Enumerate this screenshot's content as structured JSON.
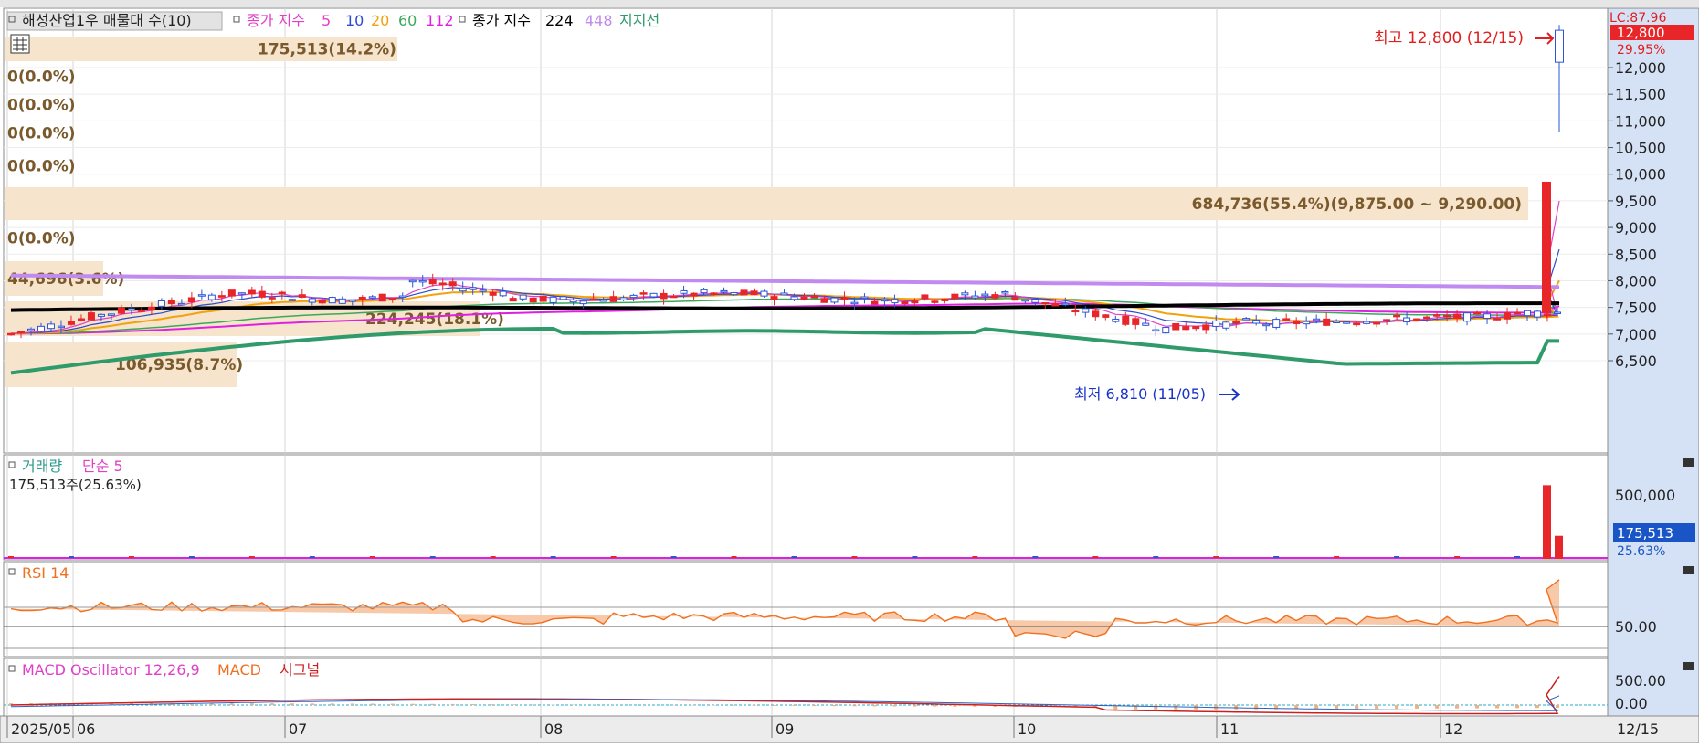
{
  "legends": {
    "price": {
      "title": "해성산업1우 매물대 수(10)",
      "ma_prefix": "종가 지수",
      "ma_periods": [
        "5",
        "10",
        "20",
        "60",
        "112"
      ],
      "long_prefix": "종가 지수",
      "long_periods": [
        "224",
        "448"
      ],
      "support": "지지선"
    },
    "volume": {
      "title": "거래량",
      "ma": "단순 5",
      "current": "175,513주(25.63%)"
    },
    "rsi": {
      "title": "RSI 14"
    },
    "macd": {
      "title": "MACD Oscillator 12,26,9",
      "macd": "MACD",
      "signal": "시그널"
    }
  },
  "colors": {
    "up": "#e8262a",
    "down": "#2b54d6",
    "ma5": "#e040c8",
    "ma10": "#2a4cd0",
    "ma20": "#f2a20c",
    "ma60": "#3aa95a",
    "ma112": "#e020e0",
    "ma224": "#000000",
    "ma448": "#c08af0",
    "support": "#2f9a6a",
    "rsi": "#f07020",
    "volume_profile": "#f6e4cc",
    "axis_bg": "#d5e2f5"
  },
  "annotations": {
    "high": "최고 12,800 (12/15)",
    "low": "최저 6,810 (11/05)",
    "lc": "LC:87.96",
    "price_tag": "12,800",
    "pct_tag": "29.95%",
    "vol_tag": "175,513",
    "vol_pct_tag": "25.63%",
    "end_date": "12/15"
  },
  "chart_data": [
    {
      "type": "candlestick",
      "title": "해성산업1우 매물대 수(10)",
      "x_range": [
        "2025/05",
        "12/15"
      ],
      "x_ticks": [
        "2025/05",
        "06",
        "07",
        "08",
        "09",
        "10",
        "11",
        "12"
      ],
      "y_ticks": [
        "6,500",
        "7,000",
        "7,500",
        "8,000",
        "8,500",
        "9,000",
        "9,500",
        "10,000",
        "10,500",
        "11,000",
        "11,500",
        "12,000"
      ],
      "ylim": [
        6250,
        13000
      ],
      "high_point": {
        "date": "12/15",
        "value": 12800
      },
      "low_point": {
        "date": "11/05",
        "value": 6810
      },
      "volume_profile_labels": [
        "175,513(14.2%)",
        "0(0.0%)",
        "0(0.0%)",
        "0(0.0%)",
        "0(0.0%)",
        "684,736(55.4%)(9,875.00 ~ 9,290.00)",
        "0(0.0%)",
        "44,696(3.6%)",
        "224,245(18.1%)",
        "106,935(8.7%)"
      ],
      "series_levels": {
        "ma224_start": 7450,
        "ma224_end": 7560,
        "ma448_start": 8100,
        "ma448_end": 7880,
        "support_start": 6270,
        "support_mid": 7100,
        "support_low": 6440,
        "support_end": 6870
      }
    },
    {
      "type": "bar",
      "title": "거래량",
      "series": [
        {
          "name": "거래량",
          "last_values": [
            560000,
            175513
          ]
        }
      ],
      "y_ticks": [
        "500,000"
      ],
      "current": "175,513주(25.63%)"
    },
    {
      "type": "line",
      "title": "RSI 14",
      "y_ticks": [
        "50.00"
      ],
      "last_value": 87.96
    },
    {
      "type": "line",
      "title": "MACD Oscillator 12,26,9",
      "series": [
        {
          "name": "MACD"
        },
        {
          "name": "시그널"
        }
      ],
      "y_ticks": [
        "500.00",
        "0.00"
      ]
    }
  ]
}
